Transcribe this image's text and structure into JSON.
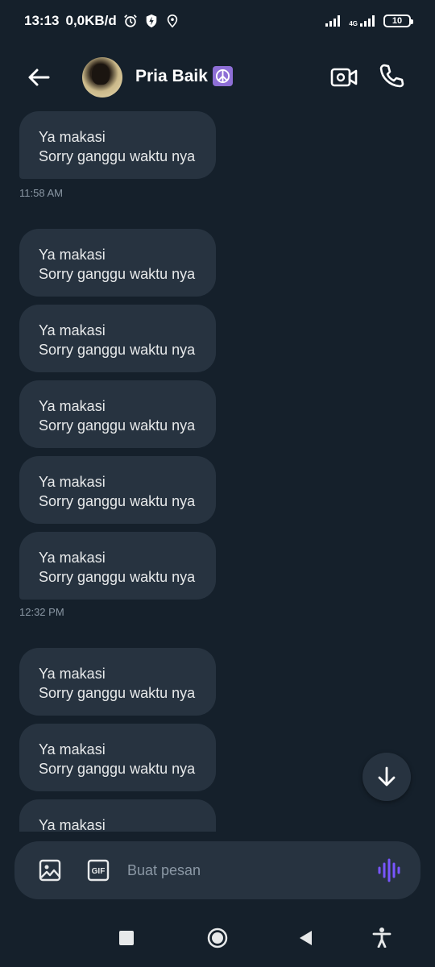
{
  "status": {
    "time": "13:13",
    "speed": "0,0KB/d",
    "network": "4G",
    "battery": "10",
    "icons": [
      "alarm-icon",
      "shield-bolt-icon",
      "location-icon",
      "signal-icon",
      "signal-4g-icon",
      "battery-icon"
    ]
  },
  "header": {
    "contact_name": "Pria Baik",
    "emoji": "☮"
  },
  "messages": [
    {
      "line1": "Ya makasi",
      "line2": "Sorry ganggu waktu nya"
    },
    {
      "line1": "Ya makasi",
      "line2": "Sorry ganggu waktu nya"
    },
    {
      "line1": "Ya makasi",
      "line2": "Sorry ganggu waktu nya"
    },
    {
      "line1": "Ya makasi",
      "line2": "Sorry ganggu waktu nya"
    },
    {
      "line1": "Ya makasi",
      "line2": "Sorry ganggu waktu nya"
    },
    {
      "line1": "Ya makasi",
      "line2": "Sorry ganggu waktu nya"
    },
    {
      "line1": "Ya makasi",
      "line2": "Sorry ganggu waktu nya"
    },
    {
      "line1": "Ya makasi",
      "line2": "Sorry ganggu waktu nya"
    },
    {
      "line1": "Ya makasi",
      "line2": ""
    }
  ],
  "timestamps": [
    "11:58 AM",
    "12:32 PM"
  ],
  "composer": {
    "placeholder": "Buat pesan",
    "gif_label": "GIF"
  },
  "colors": {
    "background": "#15202b",
    "bubble": "#273340",
    "accent_voice": "#7856ff",
    "muted_text": "#8b98a5"
  }
}
